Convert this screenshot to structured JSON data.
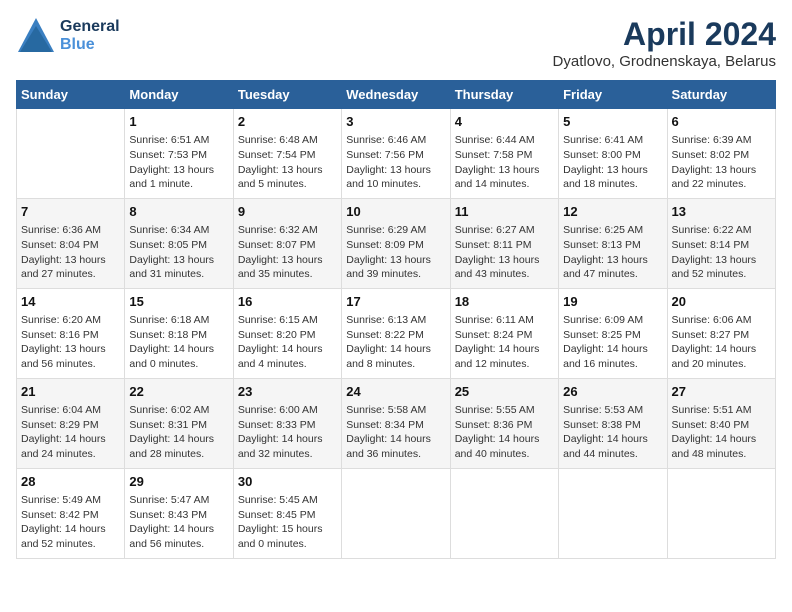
{
  "header": {
    "logo_line1": "General",
    "logo_line2": "Blue",
    "month_title": "April 2024",
    "location": "Dyatlovo, Grodnenskaya, Belarus"
  },
  "days_of_week": [
    "Sunday",
    "Monday",
    "Tuesday",
    "Wednesday",
    "Thursday",
    "Friday",
    "Saturday"
  ],
  "weeks": [
    [
      {
        "day": "",
        "content": ""
      },
      {
        "day": "1",
        "content": "Sunrise: 6:51 AM\nSunset: 7:53 PM\nDaylight: 13 hours\nand 1 minute."
      },
      {
        "day": "2",
        "content": "Sunrise: 6:48 AM\nSunset: 7:54 PM\nDaylight: 13 hours\nand 5 minutes."
      },
      {
        "day": "3",
        "content": "Sunrise: 6:46 AM\nSunset: 7:56 PM\nDaylight: 13 hours\nand 10 minutes."
      },
      {
        "day": "4",
        "content": "Sunrise: 6:44 AM\nSunset: 7:58 PM\nDaylight: 13 hours\nand 14 minutes."
      },
      {
        "day": "5",
        "content": "Sunrise: 6:41 AM\nSunset: 8:00 PM\nDaylight: 13 hours\nand 18 minutes."
      },
      {
        "day": "6",
        "content": "Sunrise: 6:39 AM\nSunset: 8:02 PM\nDaylight: 13 hours\nand 22 minutes."
      }
    ],
    [
      {
        "day": "7",
        "content": "Sunrise: 6:36 AM\nSunset: 8:04 PM\nDaylight: 13 hours\nand 27 minutes."
      },
      {
        "day": "8",
        "content": "Sunrise: 6:34 AM\nSunset: 8:05 PM\nDaylight: 13 hours\nand 31 minutes."
      },
      {
        "day": "9",
        "content": "Sunrise: 6:32 AM\nSunset: 8:07 PM\nDaylight: 13 hours\nand 35 minutes."
      },
      {
        "day": "10",
        "content": "Sunrise: 6:29 AM\nSunset: 8:09 PM\nDaylight: 13 hours\nand 39 minutes."
      },
      {
        "day": "11",
        "content": "Sunrise: 6:27 AM\nSunset: 8:11 PM\nDaylight: 13 hours\nand 43 minutes."
      },
      {
        "day": "12",
        "content": "Sunrise: 6:25 AM\nSunset: 8:13 PM\nDaylight: 13 hours\nand 47 minutes."
      },
      {
        "day": "13",
        "content": "Sunrise: 6:22 AM\nSunset: 8:14 PM\nDaylight: 13 hours\nand 52 minutes."
      }
    ],
    [
      {
        "day": "14",
        "content": "Sunrise: 6:20 AM\nSunset: 8:16 PM\nDaylight: 13 hours\nand 56 minutes."
      },
      {
        "day": "15",
        "content": "Sunrise: 6:18 AM\nSunset: 8:18 PM\nDaylight: 14 hours\nand 0 minutes."
      },
      {
        "day": "16",
        "content": "Sunrise: 6:15 AM\nSunset: 8:20 PM\nDaylight: 14 hours\nand 4 minutes."
      },
      {
        "day": "17",
        "content": "Sunrise: 6:13 AM\nSunset: 8:22 PM\nDaylight: 14 hours\nand 8 minutes."
      },
      {
        "day": "18",
        "content": "Sunrise: 6:11 AM\nSunset: 8:24 PM\nDaylight: 14 hours\nand 12 minutes."
      },
      {
        "day": "19",
        "content": "Sunrise: 6:09 AM\nSunset: 8:25 PM\nDaylight: 14 hours\nand 16 minutes."
      },
      {
        "day": "20",
        "content": "Sunrise: 6:06 AM\nSunset: 8:27 PM\nDaylight: 14 hours\nand 20 minutes."
      }
    ],
    [
      {
        "day": "21",
        "content": "Sunrise: 6:04 AM\nSunset: 8:29 PM\nDaylight: 14 hours\nand 24 minutes."
      },
      {
        "day": "22",
        "content": "Sunrise: 6:02 AM\nSunset: 8:31 PM\nDaylight: 14 hours\nand 28 minutes."
      },
      {
        "day": "23",
        "content": "Sunrise: 6:00 AM\nSunset: 8:33 PM\nDaylight: 14 hours\nand 32 minutes."
      },
      {
        "day": "24",
        "content": "Sunrise: 5:58 AM\nSunset: 8:34 PM\nDaylight: 14 hours\nand 36 minutes."
      },
      {
        "day": "25",
        "content": "Sunrise: 5:55 AM\nSunset: 8:36 PM\nDaylight: 14 hours\nand 40 minutes."
      },
      {
        "day": "26",
        "content": "Sunrise: 5:53 AM\nSunset: 8:38 PM\nDaylight: 14 hours\nand 44 minutes."
      },
      {
        "day": "27",
        "content": "Sunrise: 5:51 AM\nSunset: 8:40 PM\nDaylight: 14 hours\nand 48 minutes."
      }
    ],
    [
      {
        "day": "28",
        "content": "Sunrise: 5:49 AM\nSunset: 8:42 PM\nDaylight: 14 hours\nand 52 minutes."
      },
      {
        "day": "29",
        "content": "Sunrise: 5:47 AM\nSunset: 8:43 PM\nDaylight: 14 hours\nand 56 minutes."
      },
      {
        "day": "30",
        "content": "Sunrise: 5:45 AM\nSunset: 8:45 PM\nDaylight: 15 hours\nand 0 minutes."
      },
      {
        "day": "",
        "content": ""
      },
      {
        "day": "",
        "content": ""
      },
      {
        "day": "",
        "content": ""
      },
      {
        "day": "",
        "content": ""
      }
    ]
  ]
}
